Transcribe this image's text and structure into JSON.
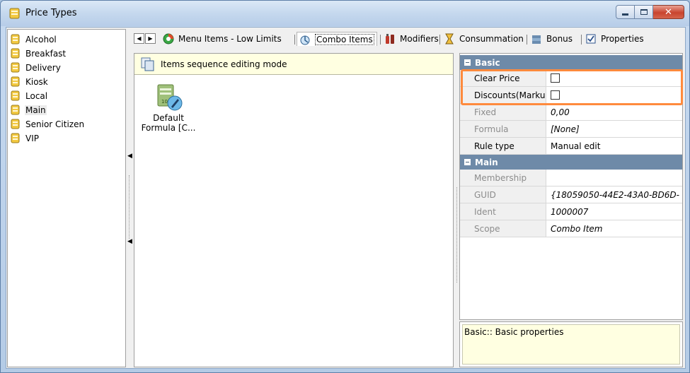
{
  "window": {
    "title": "Price Types"
  },
  "tree": {
    "items": [
      {
        "label": "Alcohol"
      },
      {
        "label": "Breakfast"
      },
      {
        "label": "Delivery"
      },
      {
        "label": "Kiosk"
      },
      {
        "label": "Local"
      },
      {
        "label": "Main"
      },
      {
        "label": "Senior Citizen"
      },
      {
        "label": "VIP"
      }
    ]
  },
  "tabs": [
    {
      "label": "Menu Items - Low Limits"
    },
    {
      "label": "Combo Items"
    },
    {
      "label": "Modifiers"
    },
    {
      "label": "Consummation"
    },
    {
      "label": "Bonus"
    },
    {
      "label": "Properties"
    }
  ],
  "midpanel": {
    "seq_mode_label": "Items sequence editing mode",
    "combo_item": {
      "label_line1": "Default",
      "label_line2": "Formula [C..."
    }
  },
  "propgrid": {
    "categories": [
      {
        "label": "Basic"
      },
      {
        "label": "Main"
      }
    ],
    "basic_rows": [
      {
        "name": "Clear Price",
        "value": ""
      },
      {
        "name": "Discounts(Marku",
        "value": ""
      },
      {
        "name": "Fixed",
        "value": "0,00"
      },
      {
        "name": "Formula",
        "value": "[None]"
      },
      {
        "name": "Rule type",
        "value": "Manual edit"
      }
    ],
    "main_rows": [
      {
        "name": "Membership",
        "value": ""
      },
      {
        "name": "GUID",
        "value": "{18059050-44E2-43A0-BD6D-"
      },
      {
        "name": "Ident",
        "value": "1000007"
      },
      {
        "name": "Scope",
        "value": "Combo Item"
      }
    ]
  },
  "description": {
    "text": "Basic:: Basic properties"
  }
}
